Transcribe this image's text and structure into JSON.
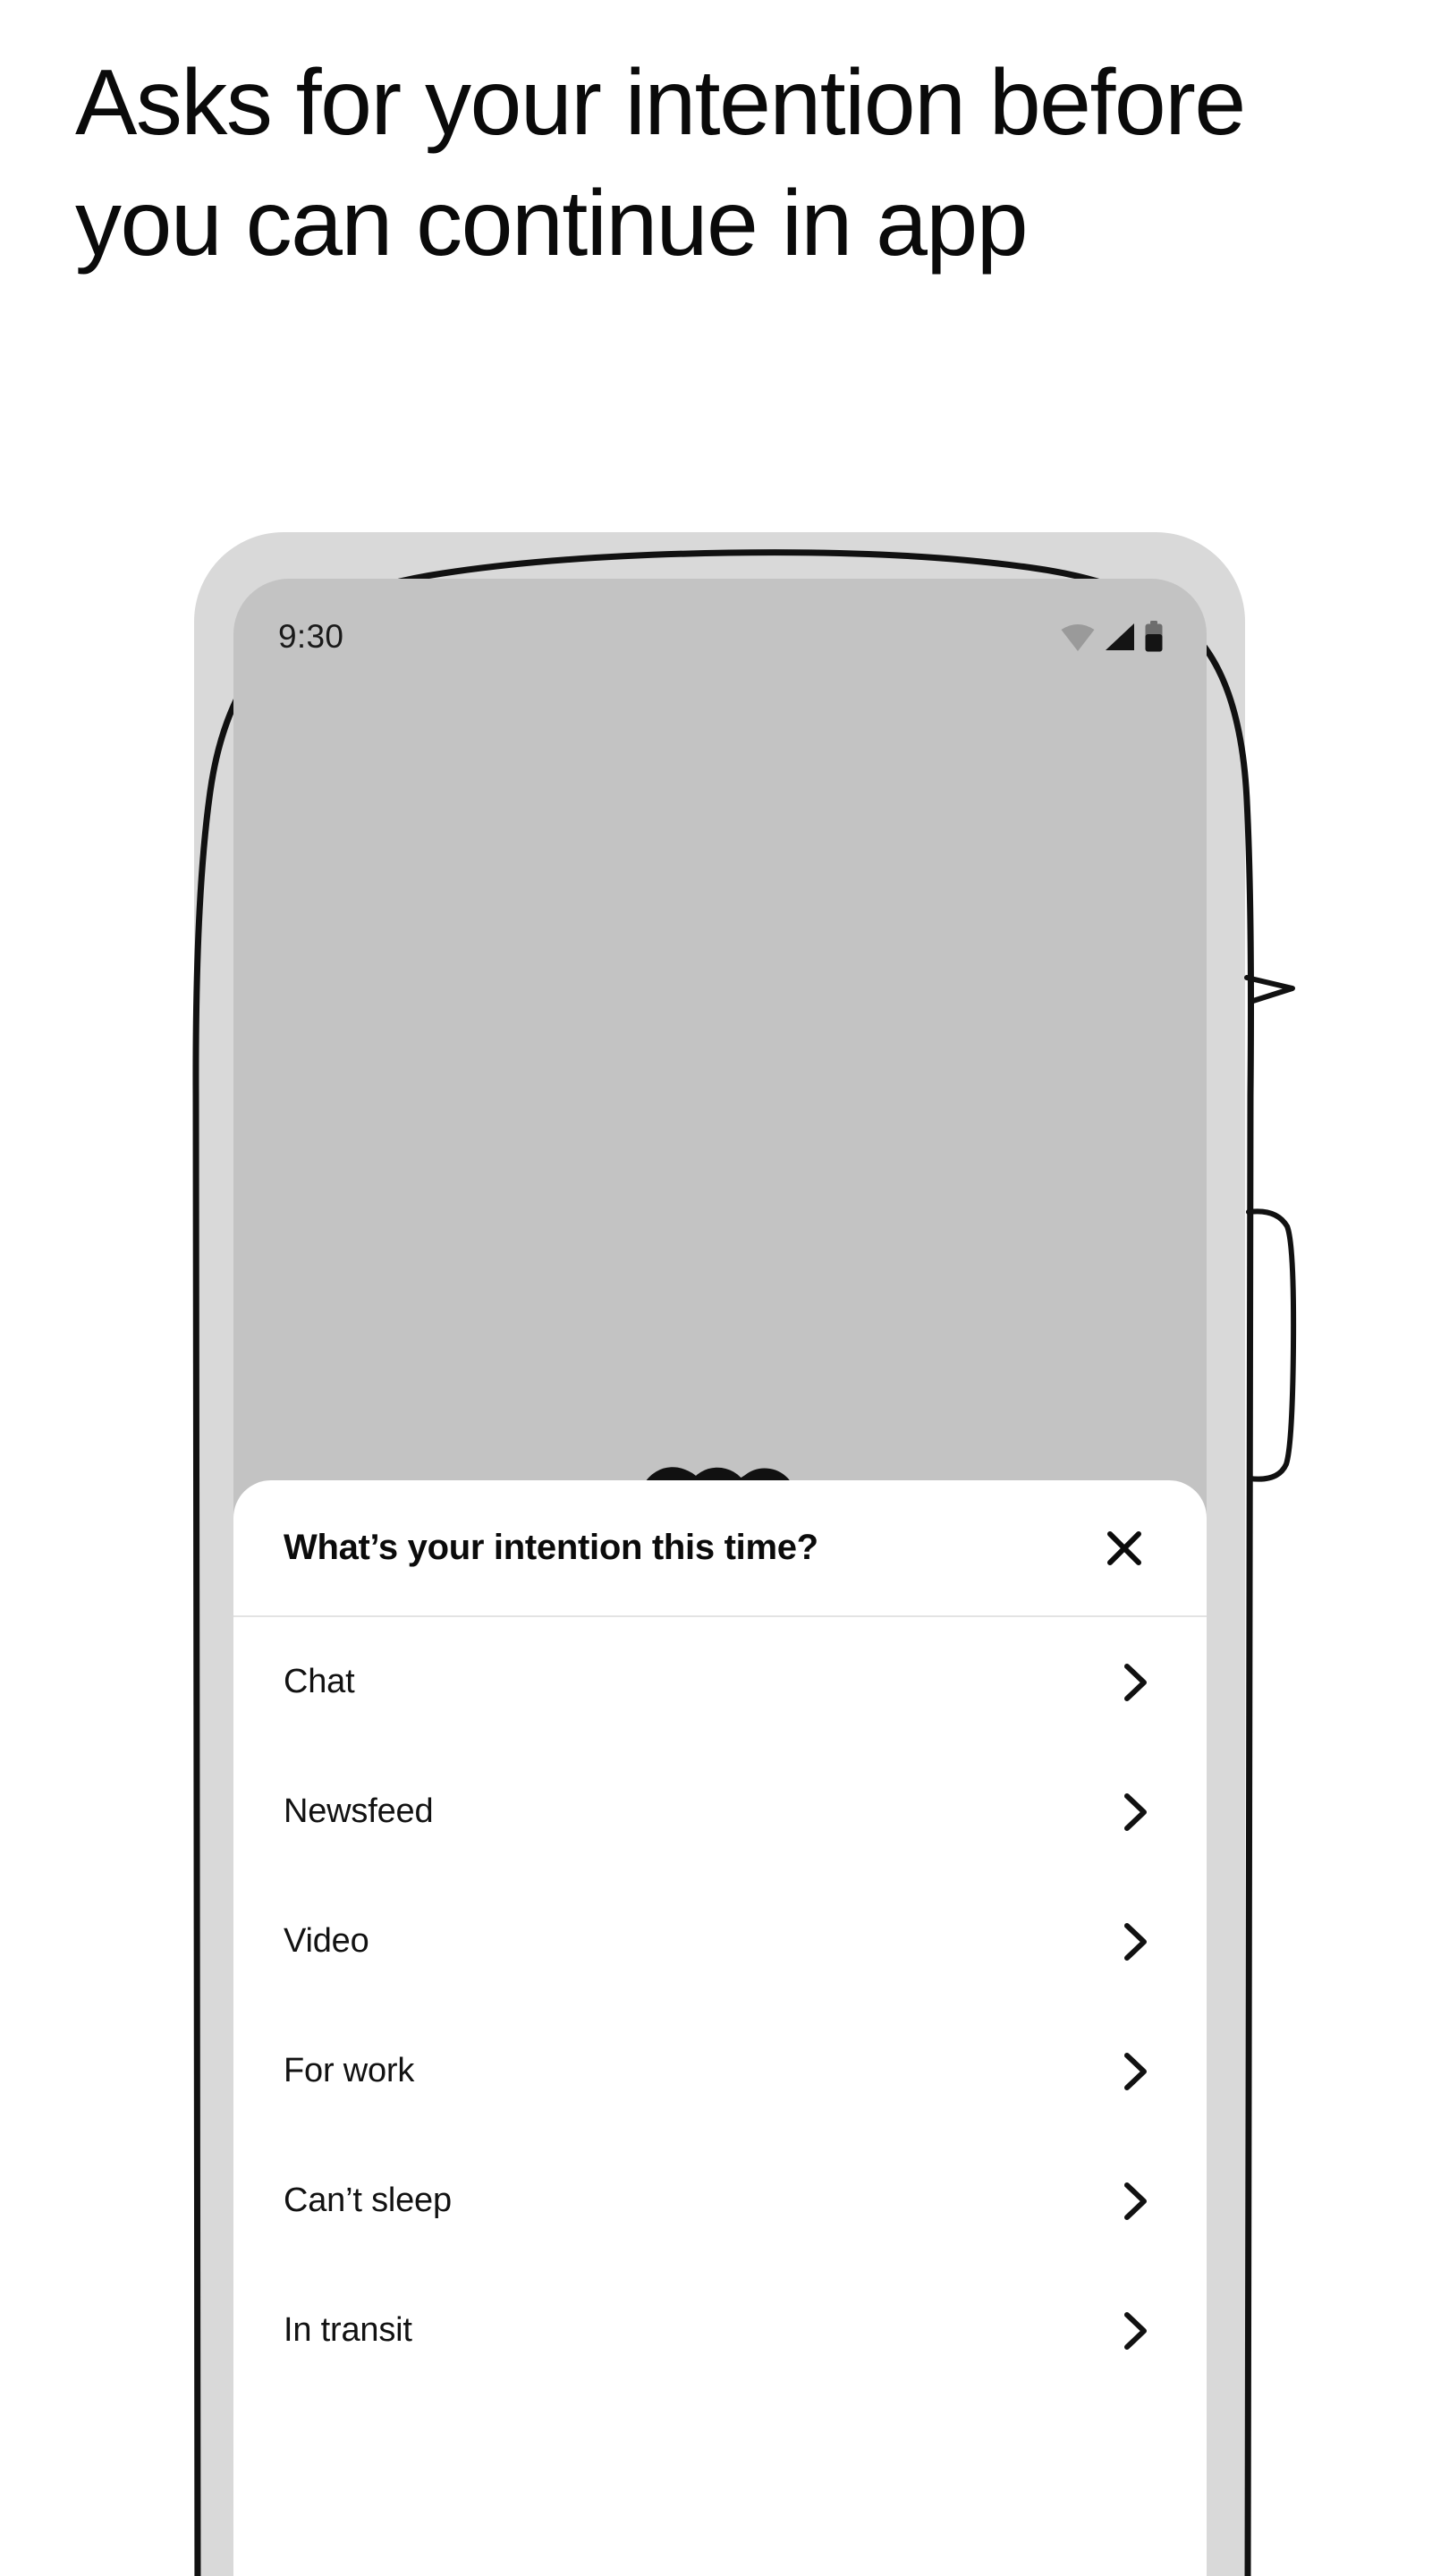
{
  "headline": "Asks for your intention before you can continue in app",
  "phone": {
    "status_bar": {
      "time": "9:30",
      "icons": [
        "wifi-icon",
        "cellular-signal-icon",
        "battery-icon"
      ]
    },
    "app_logo": "infinity-logo",
    "screen_background_color": "#c3c3c3",
    "bezel_color": "#d9d9d9",
    "outline_color": "#111111"
  },
  "sheet": {
    "title": "What’s your intention this time?",
    "close_icon": "close-x-icon",
    "background_color": "#ffffff",
    "items": [
      {
        "label": "Chat",
        "chevron": "chevron-right-icon"
      },
      {
        "label": "Newsfeed",
        "chevron": "chevron-right-icon"
      },
      {
        "label": "Video",
        "chevron": "chevron-right-icon"
      },
      {
        "label": "For work",
        "chevron": "chevron-right-icon"
      },
      {
        "label": "Can’t sleep",
        "chevron": "chevron-right-icon"
      },
      {
        "label": "In transit",
        "chevron": "chevron-right-icon"
      }
    ]
  }
}
